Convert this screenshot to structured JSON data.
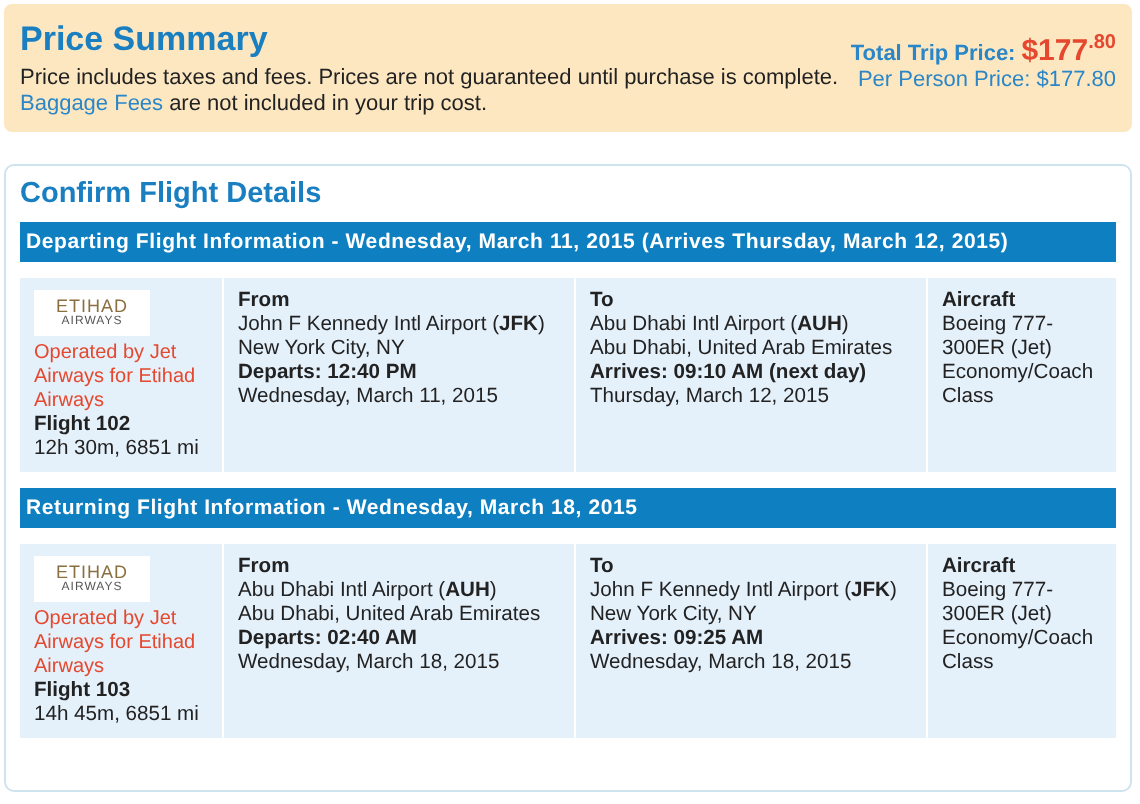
{
  "price_summary": {
    "title": "Price Summary",
    "note": "Price includes taxes and fees. Prices are not guaranteed until purchase is complete.",
    "baggage_link": "Baggage Fees",
    "baggage_note": "are not included in your trip cost.",
    "total_label": "Total Trip Price:",
    "total_price": "$177$^{.80}$",
    "per_person": "Per Person Price: $177.80"
  },
  "confirm": {
    "title": "Confirm Flight Details",
    "flights": [
      {
        "header": "Departing Flight Information - Wednesday, March 11, 2015 (Arrives Thursday, March 12, 2015)",
        "logo_text": "ETIHAD",
        "logo_subtext": "AIRWAYS",
        "operated_by": "Operated by Jet Airways for Etihad Airways",
        "flight": "Flight 102",
        "duration": "12h 30m, 6851 mi",
        "from_label": "From",
        "from_airport": "John F Kennedy Intl Airport (**JFK**)",
        "from_city": "New York City, NY",
        "departs": "Departs: 12:40 PM",
        "from_date": "Wednesday, March 11, 2015",
        "to_label": "To",
        "to_airport": "Abu Dhabi Intl Airport (**AUH**)",
        "to_city": "Abu Dhabi, United Arab Emirates",
        "arrives": "Arrives: 09:10 AM (next day)",
        "to_date": "Thursday, March 12, 2015",
        "aircraft_label": "Aircraft",
        "aircraft": "Boeing 777-300ER (Jet)",
        "cabin": "Economy/Coach Class"
      },
      {
        "header": "Returning Flight Information - Wednesday, March 18, 2015",
        "logo_text": "ETIHAD",
        "logo_subtext": "AIRWAYS",
        "operated_by": "Operated by Jet Airways for Etihad Airways",
        "flight": "Flight 103",
        "duration": "14h 45m, 6851 mi",
        "from_label": "From",
        "from_airport": "Abu Dhabi Intl Airport (**AUH**)",
        "from_city": "Abu Dhabi, United Arab Emirates",
        "departs": "Departs: 02:40 AM",
        "from_date": "Wednesday, March 18, 2015",
        "to_label": "To",
        "to_airport": "John F Kennedy Intl Airport (**JFK**)",
        "to_city": "New York City, NY",
        "arrives": "Arrives: 09:25 AM",
        "to_date": "Wednesday, March 18, 2015",
        "aircraft_label": "Aircraft",
        "aircraft": "Boeing 777-300ER (Jet)",
        "cabin": "Economy/Coach Class"
      }
    ]
  }
}
